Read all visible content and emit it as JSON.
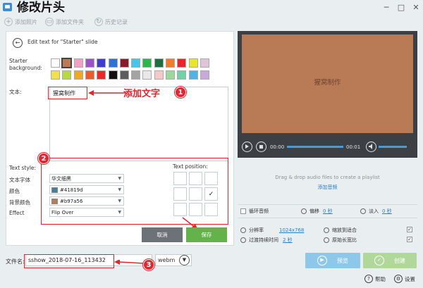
{
  "window": {
    "title": "修改片头",
    "min": "─",
    "max": "□",
    "close": "✕"
  },
  "toolbar": {
    "add_photos": "添加照片",
    "add_folder": "添加文件夹",
    "history": "历史记录"
  },
  "editor": {
    "title": "Edit text for \"Starter\" slide",
    "bg_label_line1": "Starter",
    "bg_label_line2": "background:",
    "bg_colors_row1": [
      "#ffffff",
      "#b97a56",
      "#f4a0c4",
      "#9b52c9",
      "#3d3fcb",
      "#2f6fd8",
      "#8a1c2a",
      "#47c5ea",
      "#2cb54a",
      "#1f6e3c",
      "#f17d2b",
      "#e8252f",
      "#e9e52f",
      "#e0c4d8"
    ],
    "bg_colors_row2": [
      "#f0e14a",
      "#b8d93a",
      "#f0a81e",
      "#ef5a2a",
      "#f0262a",
      "#111111",
      "#5c5c5c",
      "#a3a3a3",
      "#e8e8e8",
      "#f6c9c9",
      "#9bd99b",
      "#6fd2a8",
      "#4fb3e8",
      "#c9a8dc"
    ],
    "selected_color_index": 1,
    "text_label": "文本:",
    "text_value": "猩窝制作",
    "text_style_label": "Text style:",
    "font_label": "文本字体",
    "font_value": "华文细黑",
    "color_label": "颜色",
    "color_value": "#41819d",
    "bg_color_label": "背景颜色",
    "bg_color_value": "#b97a56",
    "effect_label": "Effect",
    "effect_value": "Flip Over",
    "text_position_label": "Text position:",
    "position_selected": 5,
    "cancel": "取消",
    "save": "保存"
  },
  "annotations": {
    "add_text": "添加文字",
    "n1": "1",
    "n2": "2",
    "n3": "3"
  },
  "preview": {
    "slide_text": "猩窝制作",
    "slide_color": "#b97a56",
    "time_start": "00:00",
    "time_end": "00:01",
    "audio_hint": "Drag & drop audio files to create a playlist",
    "add_audio": "添加音频"
  },
  "options": {
    "loop_audio": "循环音频",
    "offset_label": "偏移",
    "offset_value": "0 秒",
    "fade_in_label": "淡入",
    "fade_in_value": "0 秒",
    "resolution_label": "分辨率",
    "resolution_value": "1024x768",
    "fit_label": "缩放到适合",
    "transition_label": "过渡持续时间",
    "transition_value": "2 秒",
    "aspect_label": "原始长宽比"
  },
  "bottom": {
    "filename_label": "文件名:",
    "filename_value": "sshow_2018-07-16_113432",
    "format": "webm",
    "preview_btn": "预览",
    "create_btn": "创建",
    "help": "帮助",
    "settings": "设置"
  }
}
